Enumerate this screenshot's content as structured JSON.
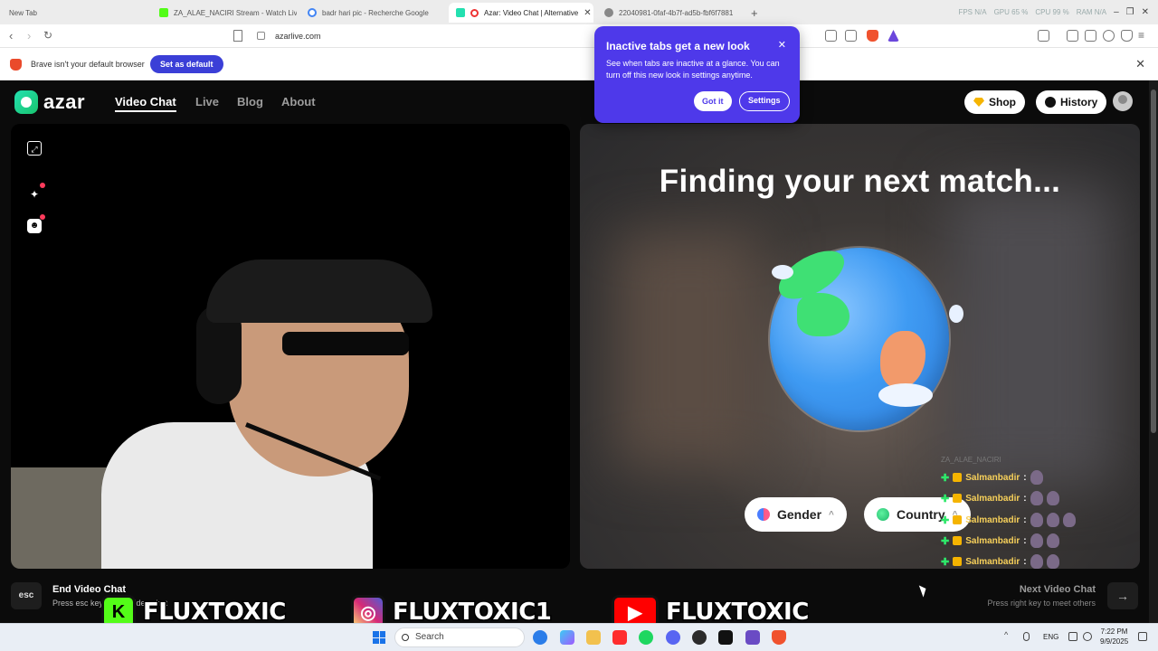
{
  "browser": {
    "tabs": [
      {
        "title": "New Tab",
        "active": false
      },
      {
        "title": "ZA_ALAE_NACIRI Stream - Watch Live",
        "active": false
      },
      {
        "title": "badr hari pic - Recherche Google",
        "active": false
      },
      {
        "title": "Azar: Video Chat | Alternative",
        "active": true
      },
      {
        "title": "22040981-0faf-4b7f-ad5b-fbf6f7881",
        "active": false
      }
    ],
    "new_tab": "+",
    "url": "azarlive.com",
    "perf_stats": {
      "fps": "FPS N/A",
      "gpu": "GPU 65 %",
      "cpu": "CPU 99 %",
      "ram": "RAM N/A"
    },
    "infobar": {
      "message": "Brave isn't your default browser",
      "set_default_label": "Set as default",
      "close": "✕"
    }
  },
  "popup": {
    "title": "Inactive tabs get a new look",
    "body": "See when tabs are inactive at a glance. You can turn off this new look in settings anytime.",
    "got_it": "Got it",
    "settings": "Settings",
    "close": "✕"
  },
  "site": {
    "logo_text": "azar",
    "nav": [
      "Video Chat",
      "Live",
      "Blog",
      "About"
    ],
    "shop_label": "Shop",
    "history_label": "History",
    "finding_text": "Finding your next match...",
    "filters": {
      "gender": "Gender",
      "country": "Country"
    },
    "bottom": {
      "esc_key": "esc",
      "end_title": "End Video Chat",
      "end_sub": "Press esc key to end video chat",
      "next_title": "Next Video Chat",
      "next_sub": "Press right key to meet others"
    }
  },
  "chat": {
    "faint_name": "ZA_ALAE_NACIRI",
    "messages": [
      {
        "user": "Salmanbadir",
        "emotes": 1
      },
      {
        "user": "Salmanbadir",
        "emotes": 2
      },
      {
        "user": "Salmanbadir",
        "emotes": 3
      },
      {
        "user": "Salmanbadir",
        "emotes": 2
      },
      {
        "user": "Salmanbadir",
        "emotes": 2
      }
    ]
  },
  "socials": [
    {
      "platform": "kick",
      "name": "FLUXTOXIC",
      "color": "#53fc18"
    },
    {
      "platform": "instagram",
      "name": "FLUXTOXIC1",
      "color": "#d62976"
    },
    {
      "platform": "youtube",
      "name": "FLUXTOXIC",
      "color": "#ff0000"
    }
  ],
  "taskbar": {
    "search": "Search",
    "lang": "ENG",
    "time": "7:22 PM",
    "date": "9/9/2025"
  },
  "colors": {
    "accent": "#4e39ea",
    "brand": "#23e0b0",
    "infobar_button": "#3b3fd7"
  }
}
